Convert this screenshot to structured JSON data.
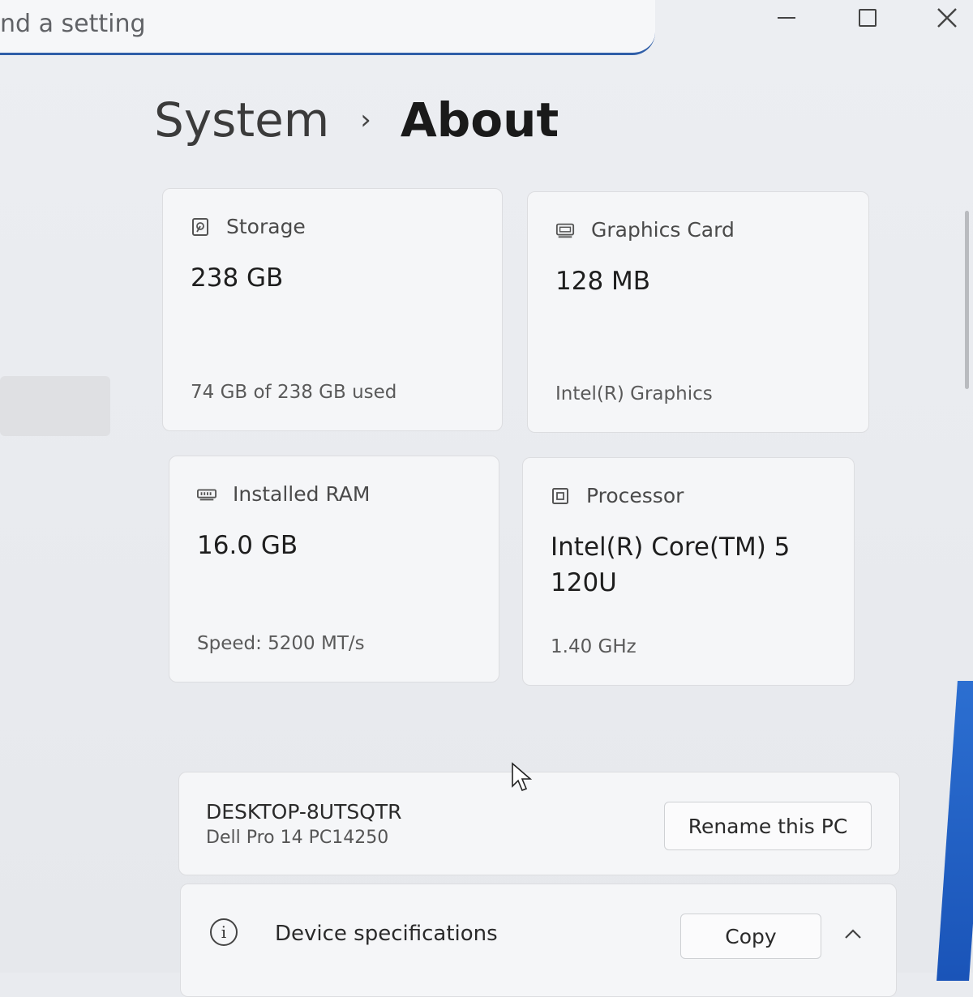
{
  "search": {
    "placeholder_visible": "nd a setting"
  },
  "window_controls": {
    "minimize_icon": "minimize-icon",
    "maximize_icon": "maximize-icon",
    "close_icon": "close-icon"
  },
  "breadcrumb": {
    "parent": "System",
    "separator": "›",
    "current": "About"
  },
  "cards": {
    "storage": {
      "icon": "storage-drive-icon",
      "title": "Storage",
      "value": "238 GB",
      "sub": "74 GB of 238 GB used"
    },
    "graphics": {
      "icon": "graphics-card-icon",
      "title": "Graphics Card",
      "value": "128 MB",
      "sub": "Intel(R) Graphics"
    },
    "ram": {
      "icon": "ram-icon",
      "title": "Installed RAM",
      "value": "16.0 GB",
      "sub": "Speed: 5200 MT/s"
    },
    "processor": {
      "icon": "processor-chip-icon",
      "title": "Processor",
      "value": "Intel(R) Core(TM) 5 120U",
      "sub": "1.40 GHz"
    }
  },
  "pc": {
    "name": "DESKTOP-8UTSQTR",
    "model": "Dell Pro 14 PC14250",
    "rename_label": "Rename this PC"
  },
  "device_specs": {
    "icon": "info-icon",
    "title": "Device specifications",
    "copy_label": "Copy",
    "toggle_icon": "chevron-up-icon"
  },
  "colors": {
    "accent": "#2f5ea8",
    "card_bg": "#f5f6f8",
    "window_bg": "#e9ebef"
  }
}
